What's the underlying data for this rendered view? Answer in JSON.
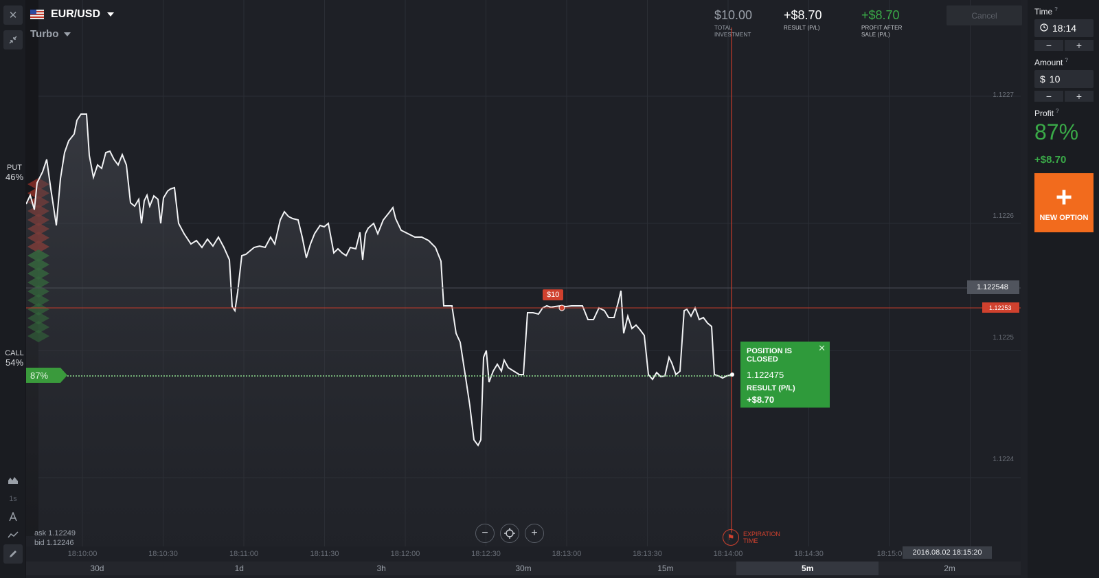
{
  "header": {
    "pair": "EUR/USD",
    "mode": "Turbo",
    "total_investment": {
      "value": "$10.00",
      "label_line1": "TOTAL",
      "label_line2": "INVESTMENT"
    },
    "result": {
      "value": "+$8.70",
      "label": "RESULT (P/L)"
    },
    "profit_after_sale": {
      "value": "+$8.70",
      "label_line1": "PROFIT AFTER",
      "label_line2": "SALE (P/L)"
    },
    "cancel_label": "Cancel"
  },
  "chart": {
    "y_labels": [
      "1.1227",
      "1.1226",
      "1.1225",
      "1.1224"
    ],
    "current_price": "1.122548",
    "strike_price": "1.12253",
    "put": {
      "label": "PUT",
      "pct": "46%"
    },
    "call": {
      "label": "CALL",
      "pct": "54%"
    },
    "payout_flag": "87%",
    "investment_tag": "$10",
    "position_closed": {
      "title": "POSITION IS CLOSED",
      "price": "1.122475",
      "result_label": "RESULT (P/L)",
      "result_value": "+$8.70"
    },
    "expiration_label_line1": "EXPIRATION",
    "expiration_label_line2": "TIME",
    "ask": "ask 1.12249",
    "bid": "bid 1.12246",
    "time_labels": [
      "18:10:00",
      "18:10:30",
      "18:11:00",
      "18:11:30",
      "18:12:00",
      "18:12:30",
      "18:13:00",
      "18:13:30",
      "18:14:00",
      "18:14:30",
      "18:15:0"
    ],
    "current_date": "2016.08.02 18:15:20",
    "side_tool_1s": "1s"
  },
  "periods": [
    {
      "label": "30d",
      "active": false
    },
    {
      "label": "1d",
      "active": false
    },
    {
      "label": "3h",
      "active": false
    },
    {
      "label": "30m",
      "active": false
    },
    {
      "label": "15m",
      "active": false
    },
    {
      "label": "5m",
      "active": true
    },
    {
      "label": "2m",
      "active": false
    }
  ],
  "right_panel": {
    "time_label": "Time",
    "time_value": "18:14",
    "amount_label": "Amount",
    "amount_currency": "$",
    "amount_value": "10",
    "profit_label": "Profit",
    "profit_pct": "87%",
    "profit_amount": "+$8.70",
    "new_option_label": "NEW OPTION",
    "minus": "−",
    "plus": "+"
  },
  "colors": {
    "accent_orange": "#f26b1d",
    "profit_green": "#3aaa48",
    "strike_red": "#d0412e"
  }
}
